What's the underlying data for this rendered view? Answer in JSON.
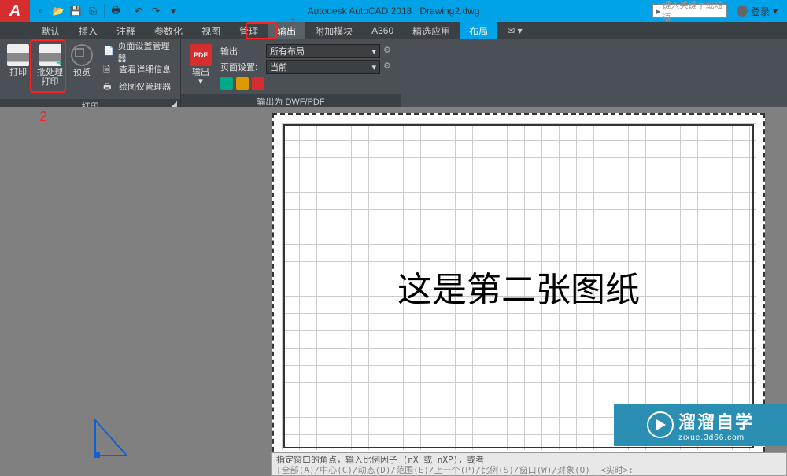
{
  "title": {
    "app": "Autodesk AutoCAD 2018",
    "doc": "Drawing2.dwg"
  },
  "search_placeholder": "键入关键字或短语",
  "login_label": "登录",
  "menu": {
    "items": [
      "默认",
      "插入",
      "注释",
      "参数化",
      "视图",
      "管理",
      "输出",
      "附加模块",
      "A360",
      "精选应用",
      "布局"
    ]
  },
  "ribbon": {
    "panel1": {
      "title": "打印",
      "btns": {
        "print": "打印",
        "batch": "批处理\n打印",
        "preview": "预览"
      },
      "side": [
        "页面设置管理器",
        "查看详细信息",
        "绘图仪管理器"
      ]
    },
    "panel2": {
      "title": "输出为 DWF/PDF",
      "export": "输出",
      "pdf_badge": "PDF",
      "rows": [
        {
          "label": "输出:",
          "value": "所有布局"
        },
        {
          "label": "页面设置:",
          "value": "当前"
        }
      ]
    }
  },
  "drawing": {
    "text": "这是第二张图纸"
  },
  "cmd": {
    "line1": "指定窗口的角点，输入比例因子 (nX 或 nXP)，或者",
    "line2": "[全部(A)/中心(C)/动态(D)/范围(E)/上一个(P)/比例(S)/窗口(W)/对象(O)] <实时>:"
  },
  "watermark": {
    "cn": "溜溜自学",
    "url": "zixue.3d66.com"
  },
  "anno": {
    "n1": "1",
    "n2": "2"
  }
}
